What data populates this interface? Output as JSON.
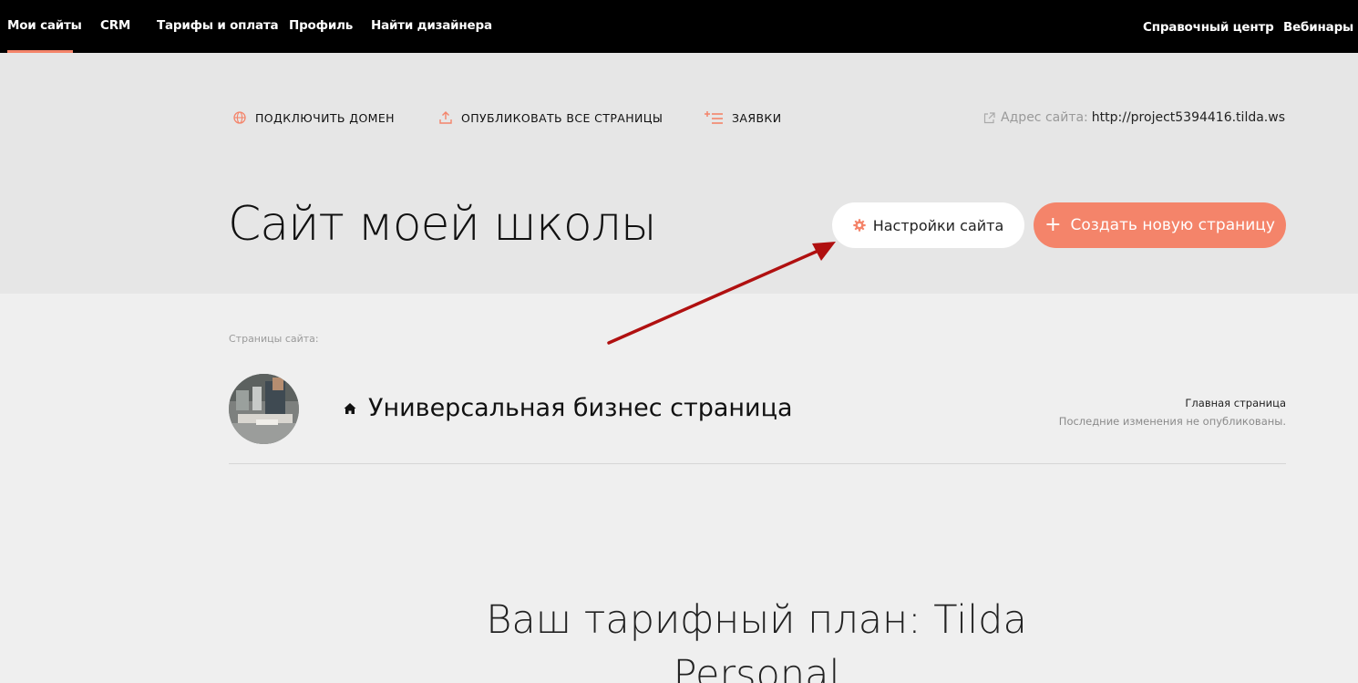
{
  "topnav": {
    "items": [
      "Мои сайты",
      "CRM",
      "Тарифы и оплата",
      "Профиль",
      "Найти дизайнера"
    ],
    "right_items": [
      "Справочный центр",
      "Вебинары"
    ],
    "active": "Мои сайты"
  },
  "actions": {
    "connect_domain": "ПОДКЛЮЧИТЬ ДОМЕН",
    "publish_all": "ОПУБЛИКОВАТЬ ВСЕ СТРАНИЦЫ",
    "leads": "ЗАЯВКИ",
    "address_label": "Адрес сайта:",
    "address_url": "http://project5394416.tilda.ws"
  },
  "site": {
    "title": "Сайт моей школы",
    "settings_button": "Настройки сайта",
    "create_button": "Создать новую страницу"
  },
  "pages": {
    "label": "Страницы сайта:",
    "items": [
      {
        "title": "Универсальная бизнес страница",
        "badge": "Главная страница",
        "status": "Последние изменения не опубликованы."
      }
    ]
  },
  "plan": {
    "line1": "Ваш тарифный план: Tilda",
    "line2": "Personal"
  },
  "colors": {
    "accent": "#f4846a",
    "nav_bg": "#000000",
    "hero_bg": "#e6e6e6",
    "page_bg": "#efefef",
    "annotation_arrow": "#b01010"
  },
  "icons": {
    "connect_domain": "globe-icon",
    "publish_all": "upload-icon",
    "leads": "list-plus-icon",
    "address": "external-link-icon",
    "settings": "gear-icon",
    "create": "plus-icon",
    "home": "home-icon"
  }
}
